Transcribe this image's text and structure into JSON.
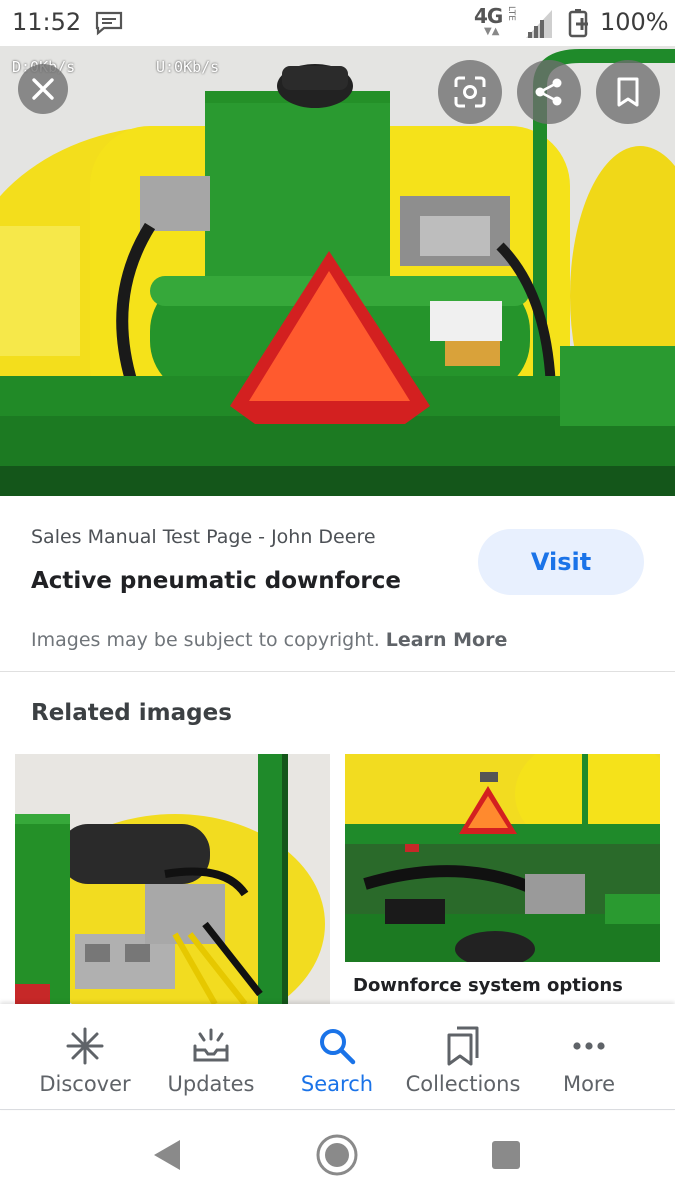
{
  "status_bar": {
    "time": "11:52",
    "network": "4G",
    "network_sub": "LTE",
    "battery": "100%"
  },
  "speed_overlay": {
    "download": "D:0Kb/s",
    "upload": "U:0Kb/s"
  },
  "result": {
    "source": "Sales Manual Test Page - John Deere",
    "title": "Active pneumatic downforce",
    "visit_label": "Visit",
    "copyright_text": "Images may be subject to copyright.",
    "learn_more": "Learn More"
  },
  "related": {
    "heading": "Related images",
    "items": [
      {
        "caption": ""
      },
      {
        "caption": "Downforce system options"
      }
    ]
  },
  "bottom_nav": {
    "items": [
      {
        "label": "Discover",
        "icon": "asterisk-icon"
      },
      {
        "label": "Updates",
        "icon": "updates-icon"
      },
      {
        "label": "Search",
        "icon": "search-icon",
        "active": true
      },
      {
        "label": "Collections",
        "icon": "collections-icon"
      },
      {
        "label": "More",
        "icon": "more-dots-icon"
      }
    ]
  },
  "colors": {
    "accent": "#1a73e8",
    "deere_green": "#2a8a2a",
    "deere_yellow": "#f5e21a"
  }
}
